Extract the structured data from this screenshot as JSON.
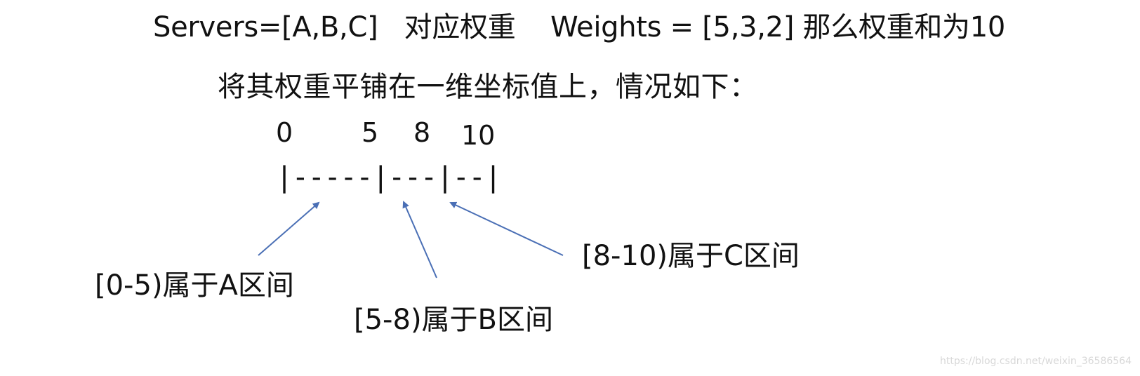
{
  "title": "Servers=[A,B,C]   对应权重    Weights = [5,3,2] 那么权重和为10",
  "subtitle": "将其权重平铺在一维坐标值上，情况如下：",
  "axis": {
    "ticks": [
      "0",
      "5",
      "8",
      "10"
    ],
    "line": "|-----|---|--|"
  },
  "labels": {
    "a": "[0-5)属于A区间",
    "b": "[5-8)属于B区间",
    "c": "[8-10)属于C区间"
  },
  "watermark": "https://blog.csdn.net/weixin_36586564",
  "colors": {
    "text": "#111111",
    "arrow": "#4a6fb5",
    "watermark": "#d8d8d8"
  }
}
